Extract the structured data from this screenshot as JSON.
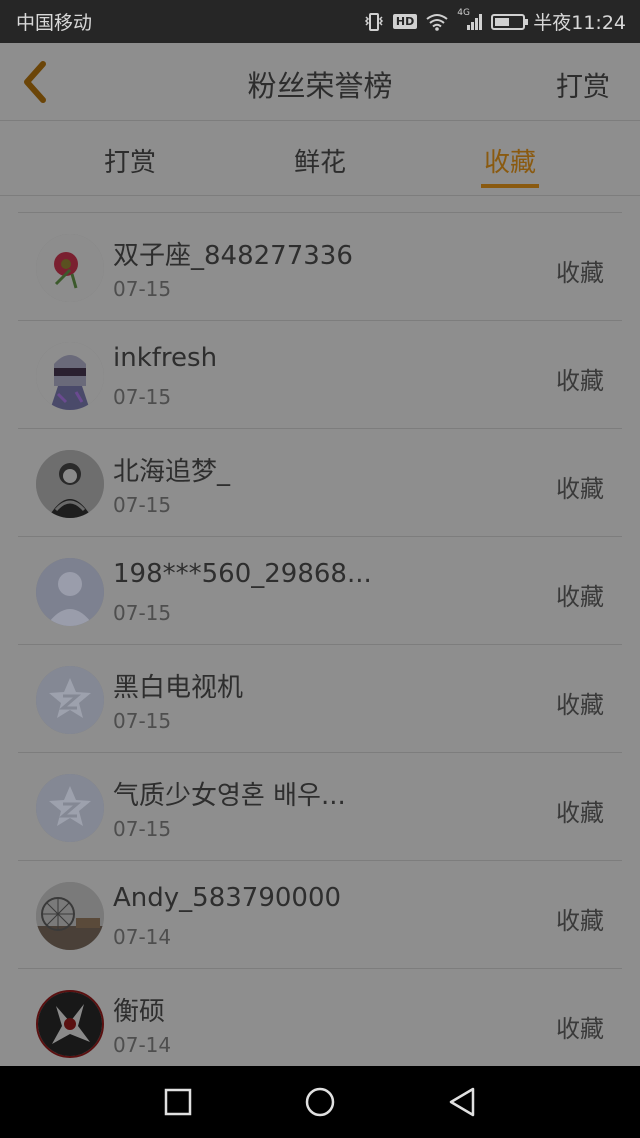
{
  "status_bar": {
    "carrier": "中国移动",
    "network_label": "4G",
    "hd_label": "HD",
    "time": "半夜11:24",
    "battery_level": 0.45,
    "icons": [
      "vibrate-icon",
      "hd-icon",
      "wifi-icon",
      "signal-icon",
      "battery-icon"
    ]
  },
  "header": {
    "title": "粉丝荣誉榜",
    "right_action": "打赏",
    "back_icon": "chevron-left-icon",
    "accent_color": "#8a5a10"
  },
  "tabs": [
    {
      "label": "打赏",
      "active": false
    },
    {
      "label": "鲜花",
      "active": false
    },
    {
      "label": "收藏",
      "active": true
    }
  ],
  "fans": [
    {
      "name": "双子座_848277336",
      "date": "07-15",
      "type": "收藏",
      "avatar": "flower-photo-avatar"
    },
    {
      "name": "inkfresh",
      "date": "07-15",
      "type": "收藏",
      "avatar": "anime-character-avatar"
    },
    {
      "name": "北海追梦_",
      "date": "07-15",
      "type": "收藏",
      "avatar": "dark-figure-avatar"
    },
    {
      "name": "198***560_29868...",
      "date": "07-15",
      "type": "收藏",
      "avatar": "default-person-avatar"
    },
    {
      "name": "黑白电视机",
      "date": "07-15",
      "type": "收藏",
      "avatar": "z-logo-avatar"
    },
    {
      "name": "气质少女영혼 배우...",
      "date": "07-15",
      "type": "收藏",
      "avatar": "z-logo-avatar"
    },
    {
      "name": "Andy_583790000",
      "date": "07-14",
      "type": "收藏",
      "avatar": "ferris-wheel-avatar"
    },
    {
      "name": "衡硕",
      "date": "07-14",
      "type": "收藏",
      "avatar": "dark-art-avatar"
    }
  ],
  "nav_bar": {
    "buttons": [
      "recent-apps-icon",
      "home-icon",
      "back-triangle-icon"
    ]
  }
}
